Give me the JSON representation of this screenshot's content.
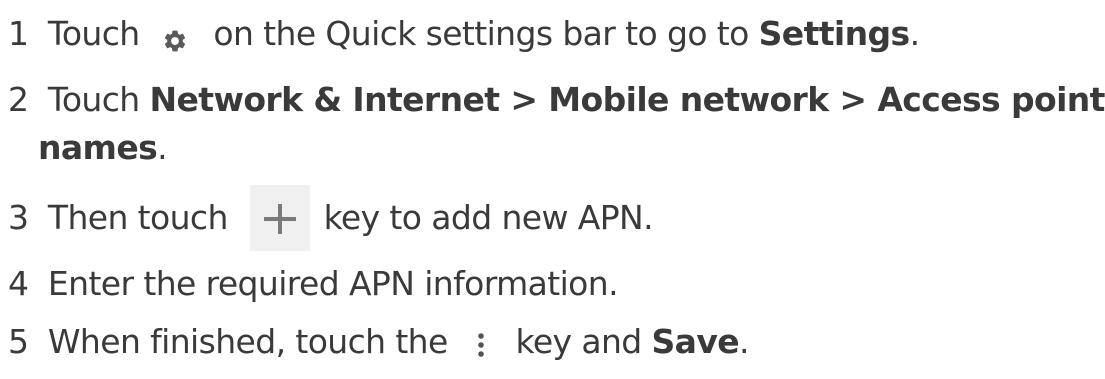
{
  "steps": [
    {
      "num": "1",
      "pre": "Touch",
      "icon": "gear-icon",
      "mid": "on the Quick settings bar to go to",
      "bold": "Settings",
      "post": "."
    },
    {
      "num": "2",
      "pre": "Touch",
      "bold": "Network & Internet > Mobile network > Access point",
      "bold2": "names",
      "post": "."
    },
    {
      "num": "3",
      "pre": "Then touch",
      "icon": "plus-icon",
      "post": "key to add new APN."
    },
    {
      "num": "4",
      "text": "Enter the required APN information."
    },
    {
      "num": "5",
      "pre": "When finished, touch the",
      "icon": "more-vert-icon",
      "mid": "key and",
      "bold": "Save",
      "post": "."
    }
  ]
}
